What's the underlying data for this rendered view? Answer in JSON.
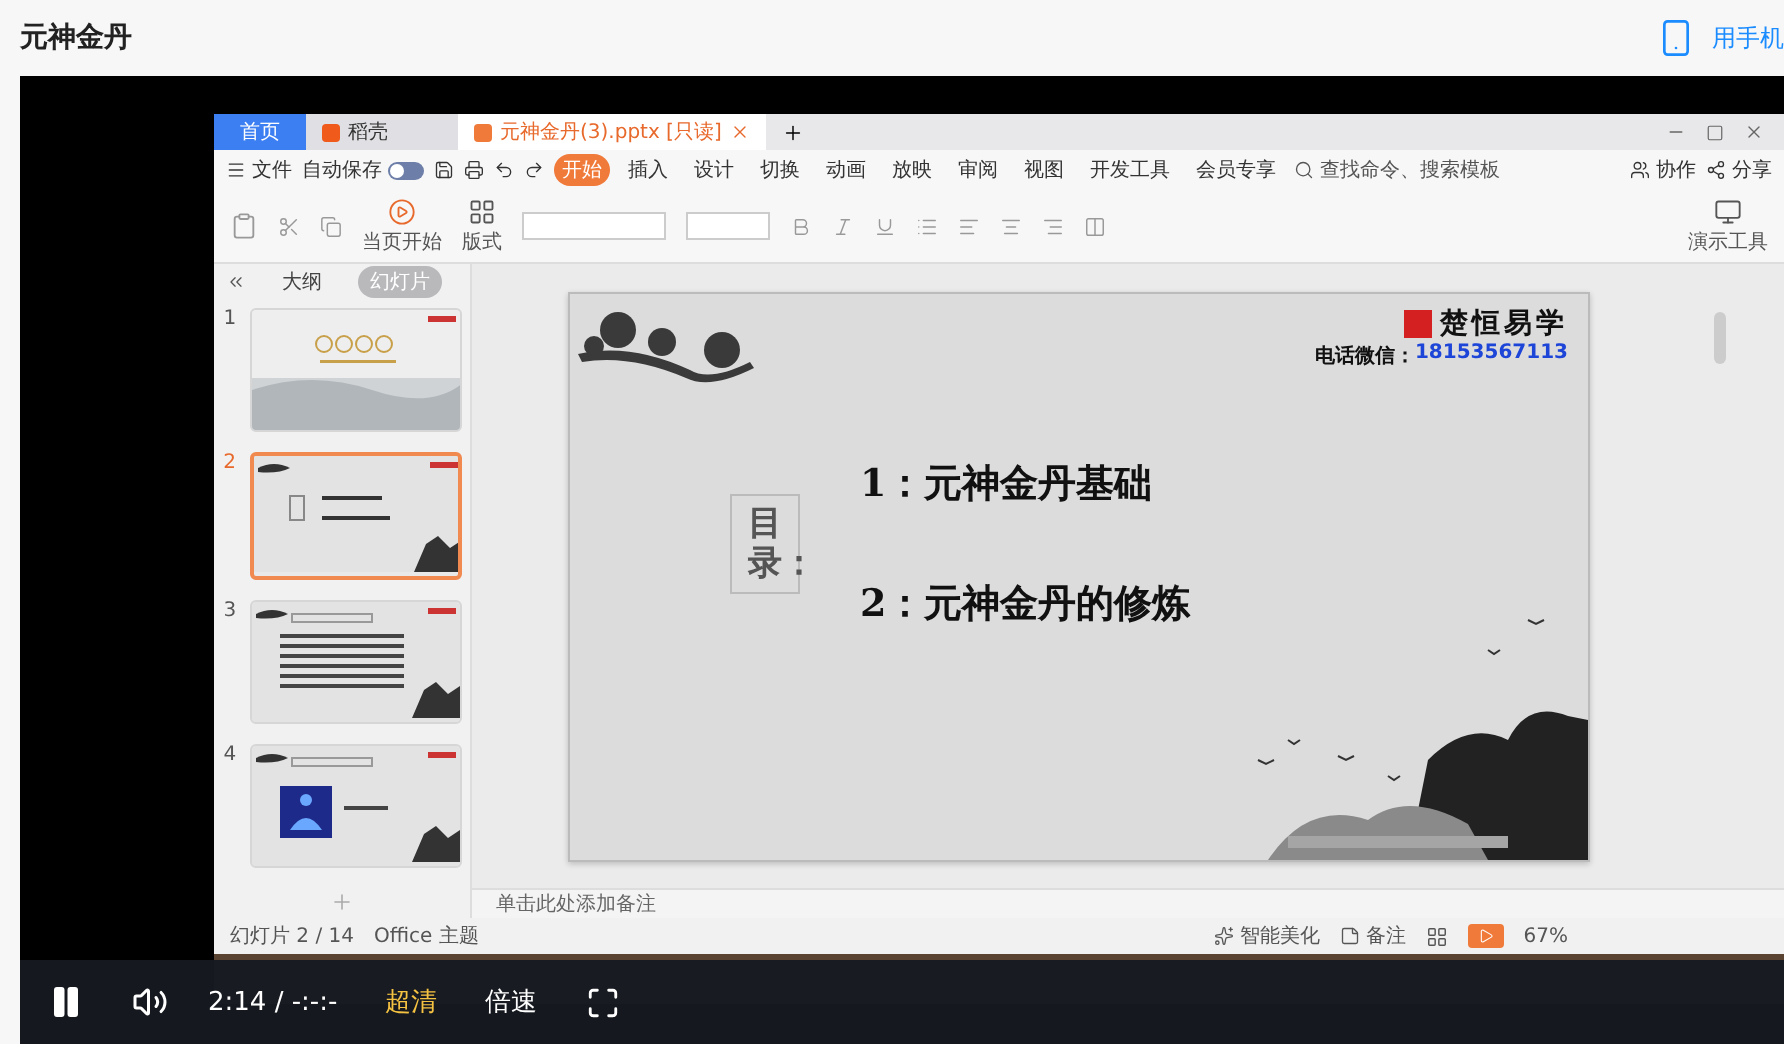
{
  "page": {
    "title": "元神金丹",
    "mobile_link": "用手机"
  },
  "recording": {
    "tabs": [
      {
        "label": "首页",
        "selected": false,
        "kind": "home"
      },
      {
        "label": "稻壳",
        "selected": false,
        "kind": "app"
      },
      {
        "label": "元神金丹(3).pptx [只读]",
        "selected": true,
        "kind": "doc"
      }
    ],
    "menu": {
      "file": "文件",
      "autosave": "自动保存",
      "autosave_on": false,
      "items": [
        {
          "label": "开始",
          "selected": true
        },
        {
          "label": "插入",
          "selected": false
        },
        {
          "label": "设计",
          "selected": false
        },
        {
          "label": "切换",
          "selected": false
        },
        {
          "label": "动画",
          "selected": false
        },
        {
          "label": "放映",
          "selected": false
        },
        {
          "label": "审阅",
          "selected": false
        },
        {
          "label": "视图",
          "selected": false
        },
        {
          "label": "开发工具",
          "selected": false
        },
        {
          "label": "会员专享",
          "selected": false
        }
      ],
      "search": {
        "placeholder": "查找命令、搜索模板"
      },
      "actions": [
        "协作",
        "分享"
      ]
    },
    "toolbar": {
      "play_from_current": "当页开始",
      "layout": "版式",
      "present_tools": "演示工具"
    },
    "sidebar": {
      "tabs": [
        {
          "label": "大纲",
          "selected": false
        },
        {
          "label": "幻灯片",
          "selected": true
        }
      ],
      "slides": [
        {
          "number": "1",
          "kind": "title",
          "selected": false
        },
        {
          "number": "2",
          "kind": "toc",
          "selected": true
        },
        {
          "number": "3",
          "kind": "text",
          "selected": false
        },
        {
          "number": "4",
          "kind": "image",
          "selected": false
        }
      ]
    },
    "slide": {
      "logo": "楚恒易学",
      "contact_label": "电话微信：",
      "phone": "18153567113",
      "heading": "目录：",
      "items": [
        "1：元神金丹基础",
        "2：元神金丹的修炼"
      ]
    },
    "notes": {
      "placeholder": "单击此处添加备注"
    },
    "status": {
      "slide_count": "幻灯片 2 / 14",
      "theme": "Office 主题",
      "beautify": "智能美化",
      "notes": "备注",
      "zoom": "67%"
    }
  },
  "player": {
    "playing": true,
    "time": "2:14 / -:-:-",
    "quality": "超清",
    "speed": "倍速"
  }
}
